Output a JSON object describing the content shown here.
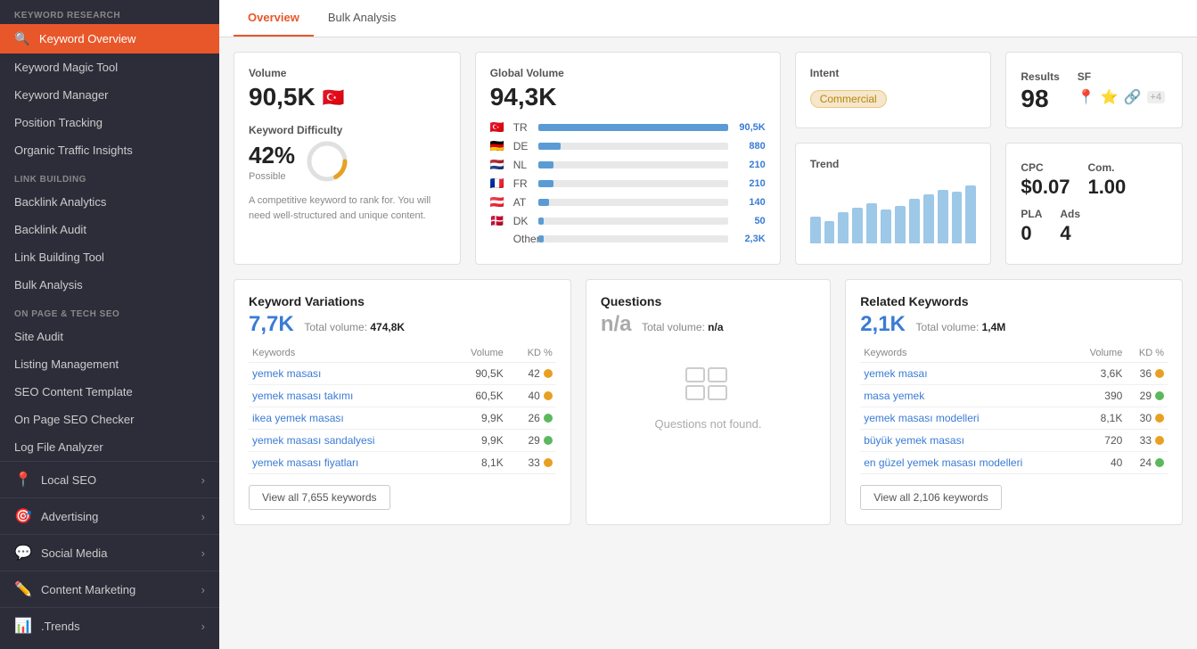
{
  "sidebar": {
    "keyword_research_label": "KEYWORD RESEARCH",
    "link_building_label": "LINK BUILDING",
    "on_page_label": "ON PAGE & TECH SEO",
    "items": {
      "keyword_overview": "Keyword Overview",
      "keyword_magic_tool": "Keyword Magic Tool",
      "keyword_manager": "Keyword Manager",
      "position_tracking": "Position Tracking",
      "organic_traffic_insights": "Organic Traffic Insights",
      "backlink_analytics": "Backlink Analytics",
      "backlink_audit": "Backlink Audit",
      "link_building_tool": "Link Building Tool",
      "bulk_analysis": "Bulk Analysis",
      "site_audit": "Site Audit",
      "listing_management": "Listing Management",
      "seo_content_template": "SEO Content Template",
      "on_page_seo_checker": "On Page SEO Checker",
      "log_file_analyzer": "Log File Analyzer"
    },
    "groups": {
      "local_seo": "Local SEO",
      "advertising": "Advertising",
      "social_media": "Social Media",
      "content_marketing": "Content Marketing",
      "trends": ".Trends"
    }
  },
  "tabs": {
    "overview": "Overview",
    "bulk_analysis": "Bulk Analysis"
  },
  "volume_card": {
    "label": "Volume",
    "value": "90,5K",
    "flag": "🇹🇷",
    "difficulty_label": "Keyword Difficulty",
    "difficulty_value": "42%",
    "difficulty_possible": "Possible",
    "difficulty_desc": "A competitive keyword to rank for. You will need well-structured and unique content."
  },
  "global_volume_card": {
    "label": "Global Volume",
    "value": "94,3K",
    "countries": [
      {
        "flag": "🇹🇷",
        "code": "TR",
        "bar": 100,
        "value": "90,5K"
      },
      {
        "flag": "🇩🇪",
        "code": "DE",
        "bar": 12,
        "value": "880"
      },
      {
        "flag": "🇳🇱",
        "code": "NL",
        "bar": 8,
        "value": "210"
      },
      {
        "flag": "🇫🇷",
        "code": "FR",
        "bar": 8,
        "value": "210"
      },
      {
        "flag": "🇦🇹",
        "code": "AT",
        "bar": 6,
        "value": "140"
      },
      {
        "flag": "🇩🇰",
        "code": "DK",
        "bar": 3,
        "value": "50"
      },
      {
        "code": "Other",
        "bar": 3,
        "value": "2,3K"
      }
    ]
  },
  "intent_card": {
    "label": "Intent",
    "badge": "Commercial"
  },
  "results_card": {
    "results_label": "Results",
    "results_value": "98",
    "sf_label": "SF"
  },
  "trend_card": {
    "label": "Trend",
    "bars": [
      30,
      25,
      35,
      40,
      45,
      38,
      42,
      50,
      55,
      60,
      58,
      65
    ]
  },
  "cpc_card": {
    "cpc_label": "CPC",
    "cpc_value": "$0.07",
    "com_label": "Com.",
    "com_value": "1.00",
    "pla_label": "PLA",
    "pla_value": "0",
    "ads_label": "Ads",
    "ads_value": "4"
  },
  "keyword_variations": {
    "title": "Keyword Variations",
    "count": "7,7K",
    "total_label": "Total volume:",
    "total_value": "474,8K",
    "col_keywords": "Keywords",
    "col_volume": "Volume",
    "col_kd": "KD %",
    "rows": [
      {
        "keyword": "yemek masası",
        "volume": "90,5K",
        "kd": 42,
        "color": "#e8a020"
      },
      {
        "keyword": "yemek masası takımı",
        "volume": "60,5K",
        "kd": 40,
        "color": "#e8a020"
      },
      {
        "keyword": "ikea yemek masası",
        "volume": "9,9K",
        "kd": 26,
        "color": "#5cb85c"
      },
      {
        "keyword": "yemek masası sandalyesi",
        "volume": "9,9K",
        "kd": 29,
        "color": "#5cb85c"
      },
      {
        "keyword": "yemek masası fiyatları",
        "volume": "8,1K",
        "kd": 33,
        "color": "#e8a020"
      }
    ],
    "view_all": "View all 7,655 keywords"
  },
  "questions": {
    "title": "Questions",
    "count": "n/a",
    "total_label": "Total volume:",
    "total_value": "n/a",
    "empty_text": "Questions not found."
  },
  "related_keywords": {
    "title": "Related Keywords",
    "count": "2,1K",
    "total_label": "Total volume:",
    "total_value": "1,4M",
    "col_keywords": "Keywords",
    "col_volume": "Volume",
    "col_kd": "KD %",
    "rows": [
      {
        "keyword": "yemek masaı",
        "volume": "3,6K",
        "kd": 36,
        "color": "#e8a020"
      },
      {
        "keyword": "masa yemek",
        "volume": "390",
        "kd": 29,
        "color": "#5cb85c"
      },
      {
        "keyword": "yemek masası modelleri",
        "volume": "8,1K",
        "kd": 30,
        "color": "#e8a020"
      },
      {
        "keyword": "büyük yemek masası",
        "volume": "720",
        "kd": 33,
        "color": "#e8a020"
      },
      {
        "keyword": "en güzel yemek masası modelleri",
        "volume": "40",
        "kd": 24,
        "color": "#5cb85c"
      }
    ],
    "view_all": "View all 2,106 keywords"
  }
}
